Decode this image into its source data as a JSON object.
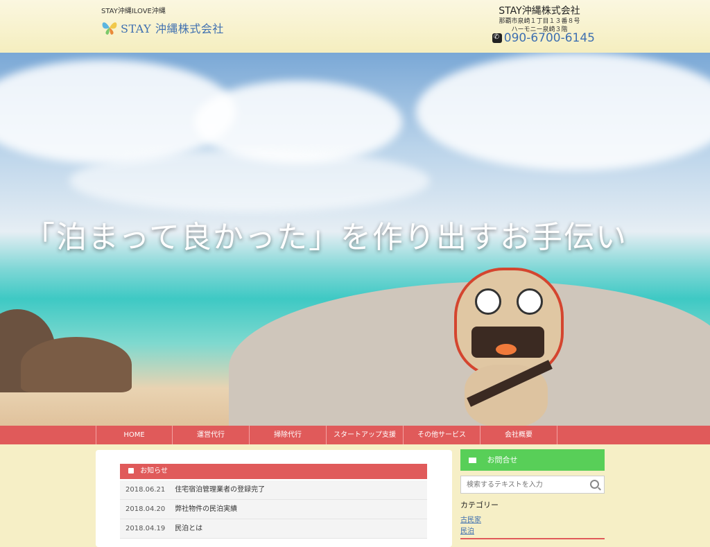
{
  "header": {
    "tagline": "STAY沖縄ILOVE沖縄",
    "logo_text": "STAY 沖縄株式会社",
    "company_name": "STAY沖縄株式会社",
    "address_1": "那覇市泉崎１丁目１３番８号",
    "address_2": "ハーモニー泉崎３階",
    "tel": "090-6700-6145"
  },
  "hero": {
    "title": "「泊まって良かった」を作り出すお手伝い"
  },
  "nav": {
    "items": [
      "HOME",
      "運営代行",
      "掃除代行",
      "スタートアップ支援",
      "その他サービス",
      "会社概要"
    ]
  },
  "news": {
    "heading": "お知らせ",
    "items": [
      {
        "date": "2018.06.21",
        "title": "住宅宿泊管理業者の登録完了"
      },
      {
        "date": "2018.04.20",
        "title": "弊社物件の民泊実績"
      },
      {
        "date": "2018.04.19",
        "title": "民泊とは"
      }
    ]
  },
  "sidebar": {
    "contact_label": "お問合せ",
    "search_placeholder": "検索するテキストを入力",
    "category_title": "カテゴリー",
    "categories": [
      "古民家",
      "民泊"
    ]
  },
  "colors": {
    "accent_red": "#e05a5a",
    "contact_green": "#58cf58",
    "link_blue": "#3e6fb0"
  }
}
